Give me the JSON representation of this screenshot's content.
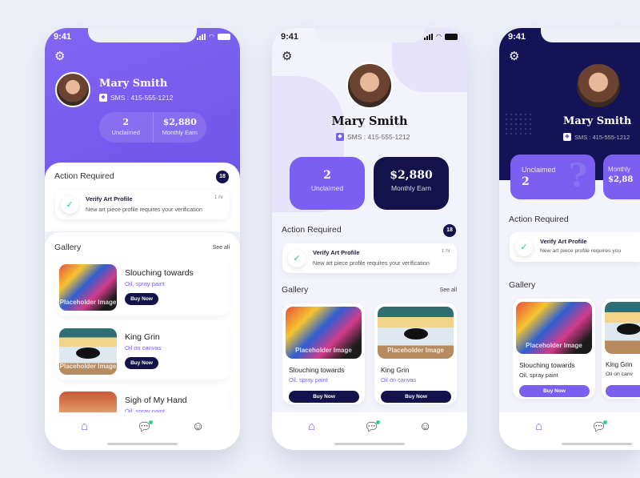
{
  "colors": {
    "accent": "#7a5ff0",
    "navy": "#14124a",
    "background": "#eef0f8",
    "online": "#2fd08a"
  },
  "profile": {
    "time": "9:41",
    "name": "Mary Smith",
    "sms": "SMS : 415-555-1212",
    "unclaimed_value": "2",
    "unclaimed_label": "Unclaimed",
    "earn_value": "$2,880",
    "earn_label": "Monthly Earn",
    "earn_label_short": "Monthly",
    "earn_value_clipped": "$2,88"
  },
  "action": {
    "title": "Action Required",
    "count": "18",
    "notification": {
      "title": "Verify Art Profile",
      "desc": "New art piece profile requires your verification",
      "desc_clipped": "New art piece profile requires you",
      "time": "1 hr"
    }
  },
  "gallery": {
    "title": "Gallery",
    "see_all": "See all",
    "placeholder": "Placeholder Image",
    "buy": "Buy Now",
    "items": [
      {
        "title": "Slouching towards",
        "medium": "Oil, spray paint"
      },
      {
        "title": "King Grin",
        "medium": "Oil on canvas",
        "medium_clipped": "Oil on canv"
      },
      {
        "title": "Sigh of My Hand",
        "medium": "Oil, spray paint"
      }
    ]
  },
  "icons": {
    "settings": "gear-icon",
    "home": "home-icon",
    "chat": "chat-icon",
    "profile": "smiley-icon",
    "verify": "check-badge-icon"
  }
}
